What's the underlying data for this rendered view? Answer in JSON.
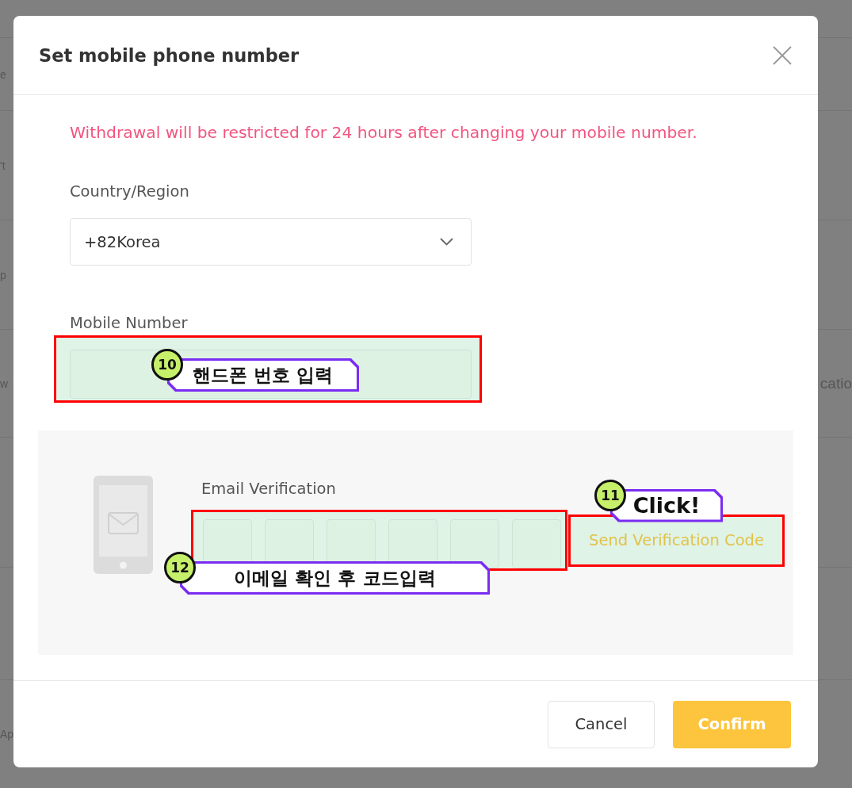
{
  "background_page": {
    "left_edge_texts": [
      "e",
      "'t",
      "p",
      "w",
      "Ap"
    ],
    "right_edge_texts": [
      "catio"
    ]
  },
  "dialog": {
    "title": "Set mobile phone number",
    "notice": "Withdrawal will be restricted for 24 hours after changing your mobile number.",
    "country": {
      "label": "Country/Region",
      "value": "+82Korea"
    },
    "mobile_number": {
      "label": "Mobile Number",
      "highlighted": true,
      "callout": {
        "number": "10",
        "text": "핸드폰 번호 입력"
      }
    },
    "email_verification": {
      "label": "Email Verification",
      "code_input": {
        "highlighted": true,
        "callout": {
          "number": "12",
          "text": "이메일 확인 후 코드입력"
        }
      },
      "send_button": {
        "label": "Send Verification Code",
        "highlighted": true,
        "callout": {
          "number": "11",
          "text": "Click!"
        }
      }
    },
    "buttons": [
      {
        "kind": "secondary",
        "label": "Cancel"
      },
      {
        "kind": "primary",
        "label": "Confirm"
      }
    ]
  }
}
